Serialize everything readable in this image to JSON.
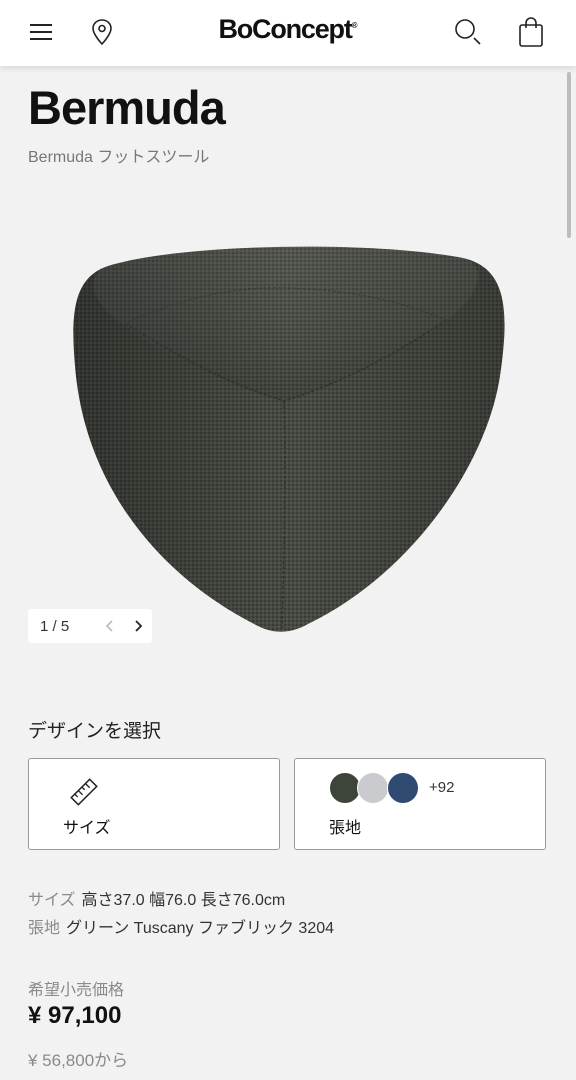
{
  "header": {
    "logo_text": "BoConcept",
    "logo_mark": "®",
    "icons": [
      "menu-icon",
      "location-pin-icon",
      "search-icon",
      "shopping-bag-icon"
    ]
  },
  "product": {
    "name": "Bermuda",
    "subtitle": "Bermuda フットスツール",
    "fabric_color": "#4a4d47"
  },
  "gallery": {
    "counter": "1 / 5",
    "prev_icon": "chevron-left-icon",
    "next_icon": "chevron-right-icon"
  },
  "design": {
    "heading": "デザインを選択",
    "size_option": {
      "label": "サイズ",
      "icon": "ruler-icon"
    },
    "fabric_option": {
      "label": "張地",
      "more_count": "+92",
      "swatch_colors": [
        "#3d4439",
        "#c9cbce",
        "#2f4a70"
      ]
    }
  },
  "specs": {
    "size_key": "サイズ",
    "size_value": "高さ37.0 幅76.0 長さ76.0cm",
    "fabric_key": "張地",
    "fabric_value": "グリーン Tuscany ファブリック 3204"
  },
  "price": {
    "label": "希望小売価格",
    "value": "¥ 97,100",
    "from": "¥ 56,800から"
  }
}
